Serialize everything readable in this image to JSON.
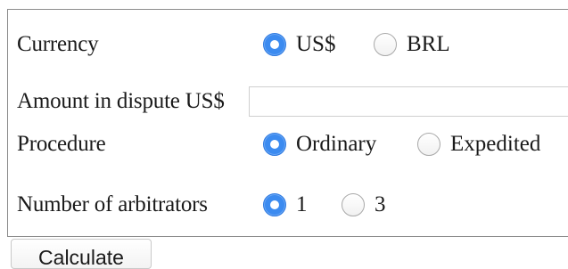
{
  "form": {
    "currency": {
      "label": "Currency",
      "options": [
        {
          "label": "US$",
          "checked": true
        },
        {
          "label": "BRL",
          "checked": false
        }
      ]
    },
    "amount": {
      "label": "Amount in dispute US$",
      "value": "",
      "placeholder": ""
    },
    "procedure": {
      "label": "Procedure",
      "options": [
        {
          "label": "Ordinary",
          "checked": true
        },
        {
          "label": "Expedited",
          "checked": false
        }
      ]
    },
    "arbitrators": {
      "label": "Number of arbitrators",
      "options": [
        {
          "label": "1",
          "checked": true
        },
        {
          "label": "3",
          "checked": false
        }
      ]
    }
  },
  "actions": {
    "calculate_label": "Calculate"
  },
  "colors": {
    "radio_checked": "#3c8bf0",
    "radio_unchecked_border": "#a9a9a9",
    "panel_border": "#8c8c8c"
  },
  "icons": {
    "radio_checked": "radio-checked-icon",
    "radio_unchecked": "radio-unchecked-icon"
  }
}
